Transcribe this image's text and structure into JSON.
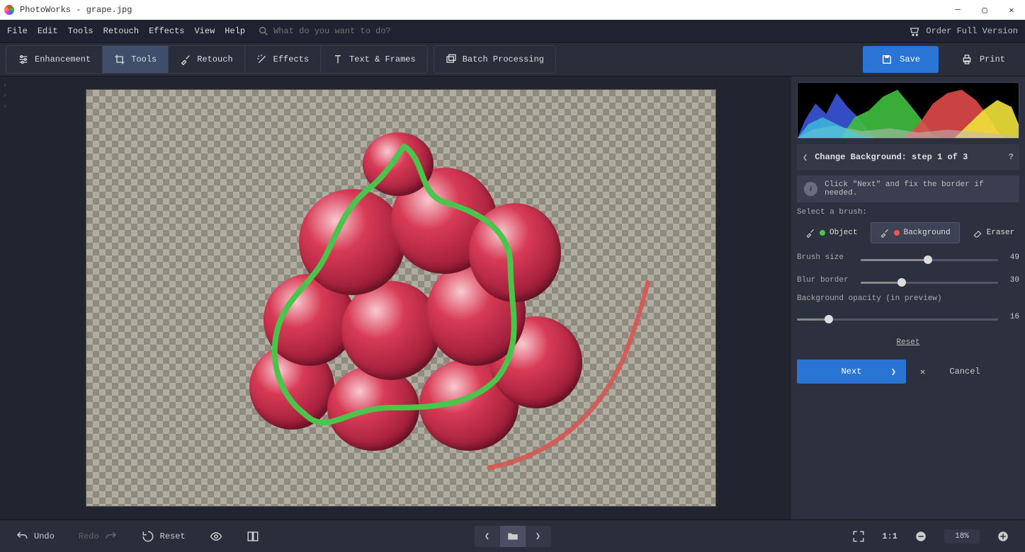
{
  "app": {
    "title": "PhotoWorks - grape.jpg"
  },
  "menu": {
    "items": [
      "File",
      "Edit",
      "Tools",
      "Retouch",
      "Effects",
      "View",
      "Help"
    ],
    "search_placeholder": "What do you want to do?",
    "order": "Order Full Version"
  },
  "toolbar": {
    "enhancement": "Enhancement",
    "tools": "Tools",
    "retouch": "Retouch",
    "effects": "Effects",
    "text_frames": "Text & Frames",
    "batch": "Batch Processing",
    "save": "Save",
    "print": "Print"
  },
  "panel": {
    "title": "Change Background: step 1 of 3",
    "tip": "Click \"Next\" and fix the border if needed.",
    "brush_label": "Select a brush:",
    "object": "Object",
    "background": "Background",
    "eraser": "Eraser",
    "brush_size_label": "Brush size",
    "brush_size_value": "49",
    "blur_label": "Blur border",
    "blur_value": "30",
    "bg_opacity_label": "Background opacity (in preview)",
    "bg_opacity_value": "16",
    "reset": "Reset",
    "next": "Next",
    "cancel": "Cancel"
  },
  "bottom": {
    "undo": "Undo",
    "redo": "Redo",
    "reset": "Reset",
    "zoom": "18%",
    "one_to_one": "1:1"
  }
}
